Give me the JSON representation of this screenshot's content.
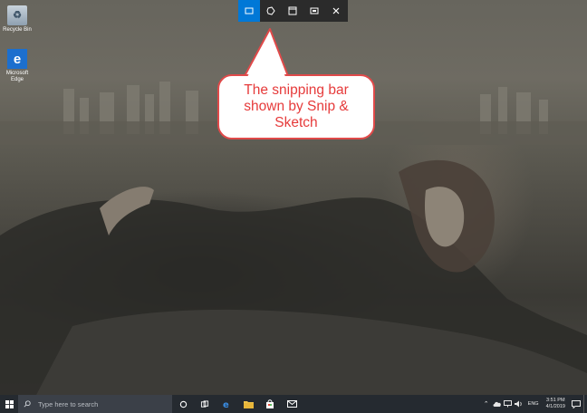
{
  "desktop": {
    "icons": [
      {
        "label": "Recycle Bin",
        "icon": "recycle-bin-icon"
      },
      {
        "label": "Microsoft Edge",
        "icon": "edge-icon"
      }
    ]
  },
  "snip_bar": {
    "buttons": [
      {
        "name": "rectangular-snip",
        "icon": "rectangle-snip-icon",
        "active": true
      },
      {
        "name": "freeform-snip",
        "icon": "freeform-snip-icon",
        "active": false
      },
      {
        "name": "window-snip",
        "icon": "window-snip-icon",
        "active": false
      },
      {
        "name": "fullscreen-snip",
        "icon": "fullscreen-snip-icon",
        "active": false
      },
      {
        "name": "close",
        "icon": "close-icon",
        "active": false
      }
    ]
  },
  "callout": {
    "text": "The snipping bar shown by Snip & Sketch"
  },
  "taskbar": {
    "search_placeholder": "Type here to search",
    "pinned": [
      {
        "name": "cortana",
        "icon": "cortana-icon"
      },
      {
        "name": "task-view",
        "icon": "task-view-icon"
      },
      {
        "name": "edge",
        "icon": "edge-icon"
      },
      {
        "name": "file-explorer",
        "icon": "folder-icon"
      },
      {
        "name": "store",
        "icon": "store-icon"
      },
      {
        "name": "mail",
        "icon": "mail-icon"
      }
    ],
    "tray": {
      "language": "ENG",
      "time": "3:51 PM",
      "date": "4/1/2019"
    }
  },
  "colors": {
    "accent": "#0078d7",
    "callout_text": "#e63b3b",
    "callout_border": "#e04a4a",
    "taskbar": "#252a30",
    "snip_bar": "#2b2b2b"
  }
}
